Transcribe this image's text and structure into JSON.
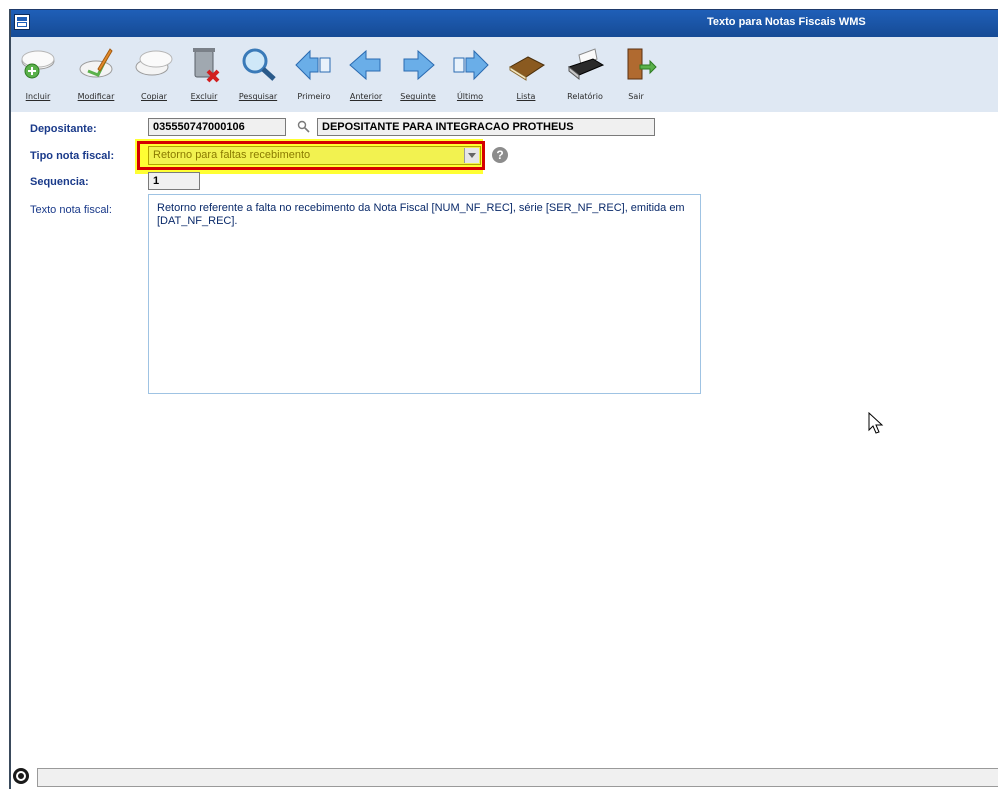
{
  "window": {
    "title": "Texto para Notas Fiscais WMS"
  },
  "toolbar": {
    "buttons": [
      {
        "label": "Incluir",
        "icon": "add-icon"
      },
      {
        "label": "Modificar",
        "icon": "edit-icon"
      },
      {
        "label": "Copiar",
        "icon": "copy-icon"
      },
      {
        "label": "Excluir",
        "icon": "delete-icon"
      },
      {
        "label": "Pesquisar",
        "icon": "search-icon"
      },
      {
        "label": "Primeiro",
        "icon": "first-icon"
      },
      {
        "label": "Anterior",
        "icon": "previous-icon"
      },
      {
        "label": "Seguinte",
        "icon": "next-icon"
      },
      {
        "label": "Último",
        "icon": "last-icon"
      },
      {
        "label": "Lista",
        "icon": "list-icon"
      },
      {
        "label": "Relatório",
        "icon": "report-icon"
      },
      {
        "label": "Sair",
        "icon": "exit-icon"
      }
    ]
  },
  "form": {
    "depositante": {
      "label": "Depositante:",
      "code": "035550747000106",
      "name": "DEPOSITANTE PARA INTEGRACAO PROTHEUS"
    },
    "tipo_nota": {
      "label": "Tipo nota fiscal:",
      "value": "Retorno para faltas recebimento"
    },
    "sequencia": {
      "label": "Sequencia:",
      "value": "1"
    },
    "texto": {
      "label": "Texto nota fiscal:",
      "value": "Retorno referente a falta no recebimento da Nota Fiscal [NUM_NF_REC], série [SER_NF_REC], emitida em [DAT_NF_REC]."
    }
  },
  "colors": {
    "titlebar": "#1f5fb8",
    "toolbar": "#dfe8f3",
    "highlight": "#ffff33",
    "highlight_border": "#d40000",
    "label": "#1a3a8a"
  }
}
